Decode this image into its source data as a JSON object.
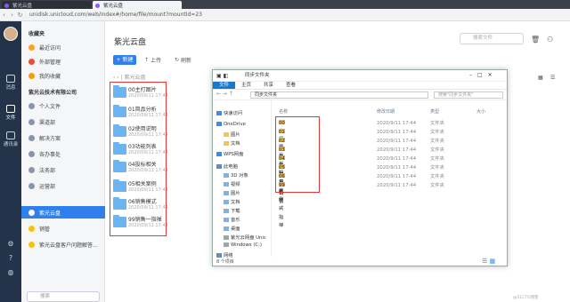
{
  "browser": {
    "tabs": [
      {
        "label": "紫光云盘"
      },
      {
        "label": "紫光云盘"
      }
    ],
    "url": "unidisk.unicloud.com/web/index#/home/file/mount?mountId=23"
  },
  "rail": {
    "items": [
      {
        "label": "消息"
      },
      {
        "label": "文件"
      },
      {
        "label": "通讯录"
      }
    ]
  },
  "sidebar": {
    "favorites_title": "收藏夹",
    "favorites": [
      {
        "label": "最近访问"
      },
      {
        "label": "外部管理"
      },
      {
        "label": "我的收藏"
      }
    ],
    "company_title": "紫光云技术有限公司",
    "items": [
      {
        "label": "个人文件"
      },
      {
        "label": "渠道部"
      },
      {
        "label": "解决方案"
      },
      {
        "label": "各办事处"
      },
      {
        "label": "法务部"
      },
      {
        "label": "运营部"
      },
      {
        "label": "紫光云盘"
      },
      {
        "label": "销管"
      },
      {
        "label": "紫光云盘客户问题解答..."
      }
    ],
    "search_placeholder": "搜索"
  },
  "main": {
    "title": "紫光云盘",
    "search_placeholder": "搜索文件",
    "new_label": "+ 新建",
    "upload_label": "上传",
    "refresh_label": "刷新",
    "breadcrumb": "紫光云盘",
    "folders": [
      {
        "name": "00主打图片",
        "date": "2020/09/11 17:44"
      },
      {
        "name": "01简品分析",
        "date": "2020/09/11 17:44"
      },
      {
        "name": "02使用说明",
        "date": "2020/09/11 17:44"
      },
      {
        "name": "03功能列表",
        "date": "2020/09/11 17:44"
      },
      {
        "name": "04投标相关",
        "date": "2020/09/11 17:44"
      },
      {
        "name": "05相关案例",
        "date": "2020/09/11 17:44"
      },
      {
        "name": "06销售模式",
        "date": "2020/09/11 17:44"
      },
      {
        "name": "99销售一指禅",
        "date": "2020/09/11 17:44"
      }
    ]
  },
  "explorer": {
    "title": "同步文件夹",
    "ribbon_tabs": [
      "文件",
      "主页",
      "共享",
      "查看"
    ],
    "address": "同步文件夹",
    "search_placeholder": "搜索\"同步文件夹\"",
    "nav": [
      {
        "label": "快速访问"
      },
      {
        "label": "OneDrive"
      },
      {
        "label": "图片"
      },
      {
        "label": "文档"
      },
      {
        "label": "WPS网盘"
      },
      {
        "label": "此电脑"
      },
      {
        "label": "3D 对象"
      },
      {
        "label": "视频"
      },
      {
        "label": "图片"
      },
      {
        "label": "文档"
      },
      {
        "label": "下载"
      },
      {
        "label": "音乐"
      },
      {
        "label": "桌面"
      },
      {
        "label": "紫光云网盘 Unic"
      },
      {
        "label": "Windows (C:)"
      },
      {
        "label": "网络"
      }
    ],
    "columns": {
      "name": "名称",
      "date": "修改日期",
      "type": "类型",
      "size": "大小"
    },
    "rows": [
      {
        "name": "00主打图片",
        "date": "2020/9/11 17:44",
        "type": "文件夹"
      },
      {
        "name": "01简品分析",
        "date": "2020/9/11 17:44",
        "type": "文件夹"
      },
      {
        "name": "02使用说明",
        "date": "2020/9/11 17:44",
        "type": "文件夹"
      },
      {
        "name": "03功能列表",
        "date": "2020/9/11 17:44",
        "type": "文件夹"
      },
      {
        "name": "04投标相关",
        "date": "2020/9/11 17:44",
        "type": "文件夹"
      },
      {
        "name": "05相关案例",
        "date": "2020/9/11 17:44",
        "type": "文件夹"
      },
      {
        "name": "06销售模式",
        "date": "2020/9/11 17:44",
        "type": "文件夹"
      },
      {
        "name": "99销售一指禅",
        "date": "2020/9/11 17:44",
        "type": "文件夹"
      }
    ],
    "status": "8 个项目"
  },
  "watermark": "@51CTO博客"
}
